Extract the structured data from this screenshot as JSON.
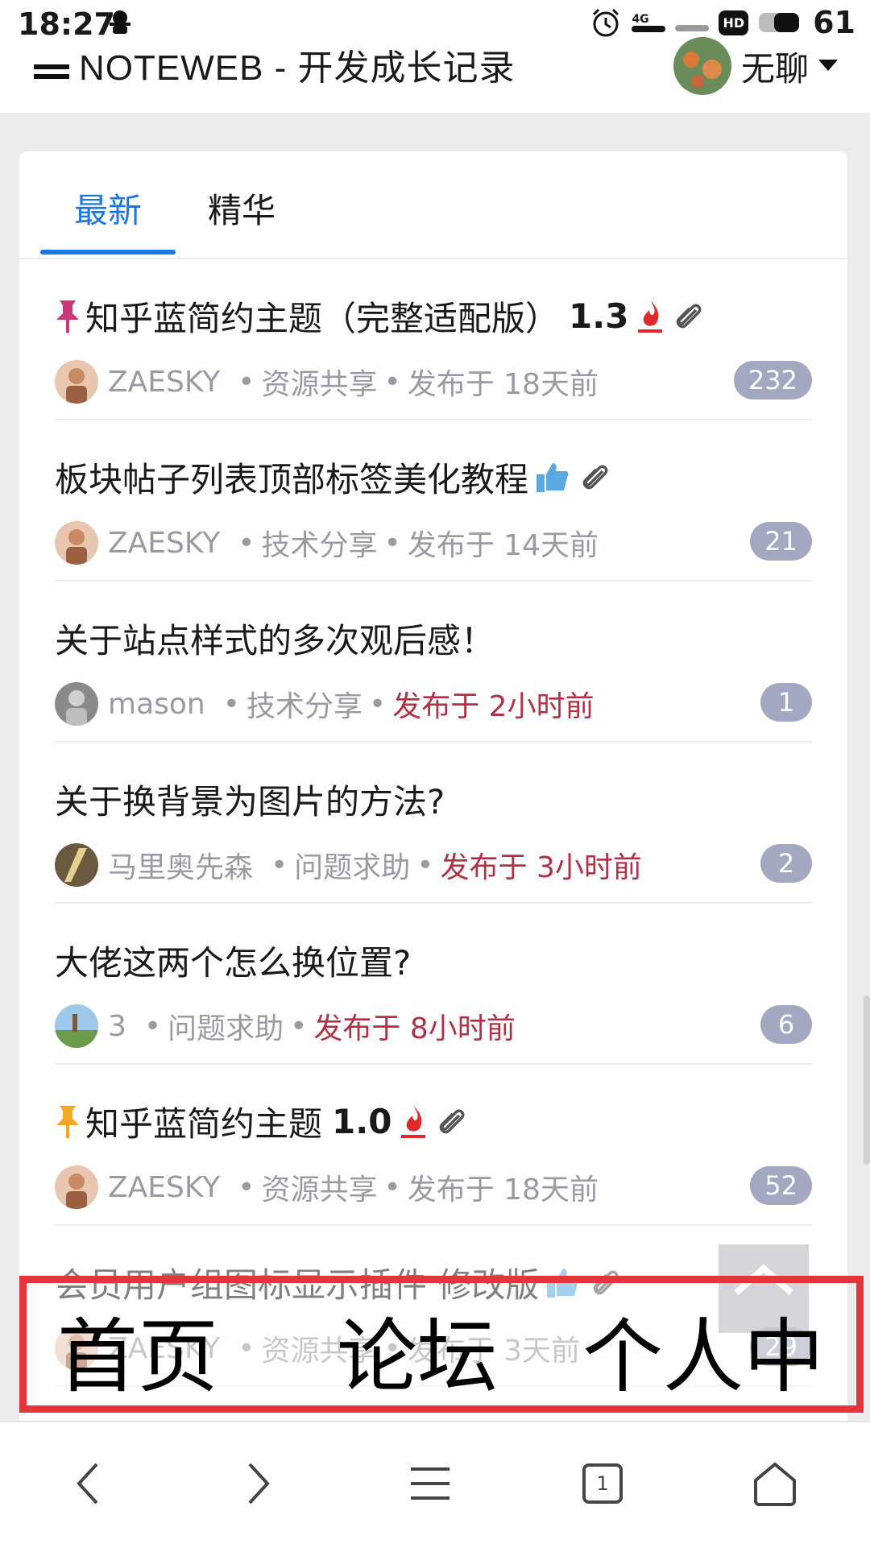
{
  "status": {
    "time": "18:27",
    "network": "4G",
    "hd": "HD",
    "battery": "61"
  },
  "header": {
    "site_title": "NOTEWEB - 开发成长记录",
    "username": "无聊"
  },
  "tabs": [
    {
      "label": "最新",
      "active": true
    },
    {
      "label": "精华",
      "active": false
    }
  ],
  "topics": [
    {
      "title": "知乎蓝简约主题（完整适配版）",
      "version": "1.3",
      "pinned": true,
      "pin_color": "#c8387a",
      "hot": true,
      "attachment": true,
      "author": "ZAESKY",
      "category": "资源共享",
      "published": "发布于 18天前",
      "recent": false,
      "replies": "232"
    },
    {
      "title": "板块帖子列表顶部标签美化教程",
      "thumb": true,
      "attachment": true,
      "author": "ZAESKY",
      "category": "技术分享",
      "published": "发布于 14天前",
      "recent": false,
      "replies": "21"
    },
    {
      "title": "关于站点样式的多次观后感！",
      "author": "mason",
      "category": "技术分享",
      "published": "发布于 2小时前",
      "recent": true,
      "replies": "1"
    },
    {
      "title": "关于换背景为图片的方法?",
      "author": "马里奥先森",
      "category": "问题求助",
      "published": "发布于 3小时前",
      "recent": true,
      "replies": "2"
    },
    {
      "title": "大佬这两个怎么换位置?",
      "author": "3",
      "category": "问题求助",
      "published": "发布于 8小时前",
      "recent": true,
      "replies": "6"
    },
    {
      "title": "知乎蓝简约主题",
      "version": "1.0",
      "pinned": true,
      "pin_color": "#f5a623",
      "hot": true,
      "attachment": true,
      "author": "ZAESKY",
      "category": "资源共享",
      "published": "发布于 18天前",
      "recent": false,
      "replies": "52"
    },
    {
      "title": "会员用户组图标显示插件 修改版",
      "thumb": true,
      "attachment": true,
      "author": "ZAESKY",
      "category": "资源共享",
      "published": "发布于 3天前",
      "recent": false,
      "replies": "29"
    }
  ],
  "overlay_nav": {
    "home": "首页",
    "forum": "论坛",
    "profile": "个人中心"
  },
  "colors": {
    "accent": "#1b78e0",
    "recent_text": "#b03046",
    "badge_bg": "#a2a8c0",
    "frame_red": "#e3353a"
  },
  "browser": {
    "tab_count": "1"
  }
}
